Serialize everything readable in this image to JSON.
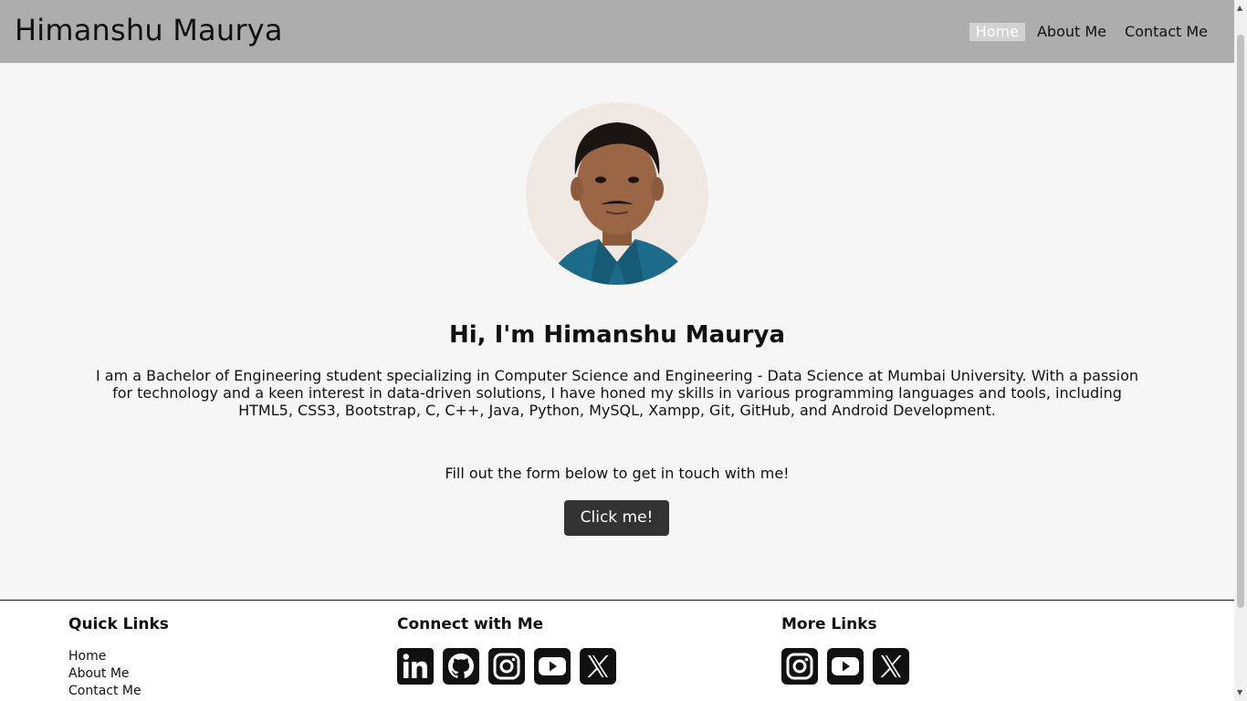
{
  "header": {
    "brand": "Himanshu Maurya",
    "nav": [
      "Home",
      "About Me",
      "Contact Me"
    ]
  },
  "hero": {
    "heading": "Hi, I'm Himanshu Maurya",
    "intro": "I am a Bachelor of Engineering student specializing in Computer Science and Engineering - Data Science at Mumbai University. With a passion for technology and a keen interest in data-driven solutions, I have honed my skills in various programming languages and tools, including HTML5, CSS3, Bootstrap, C, C++, Java, Python, MySQL, Xampp, Git, GitHub, and Android Development.",
    "cta_text": "Fill out the form below to get in touch with me!",
    "cta_button": "Click me!"
  },
  "footer": {
    "quick_links_title": "Quick Links",
    "quick_links": [
      "Home",
      "About Me",
      "Contact Me"
    ],
    "connect_title": "Connect with Me",
    "connect_icons": [
      "linkedin-icon",
      "github-icon",
      "instagram-icon",
      "youtube-icon",
      "x-icon"
    ],
    "more_title": "More Links",
    "more_icons": [
      "instagram-icon",
      "youtube-icon",
      "x-icon"
    ]
  },
  "colors": {
    "header_bg": "#adadad",
    "page_bg": "#f6f6f6",
    "button_bg": "#333333",
    "active_nav_bg": "#d2d2d2"
  }
}
